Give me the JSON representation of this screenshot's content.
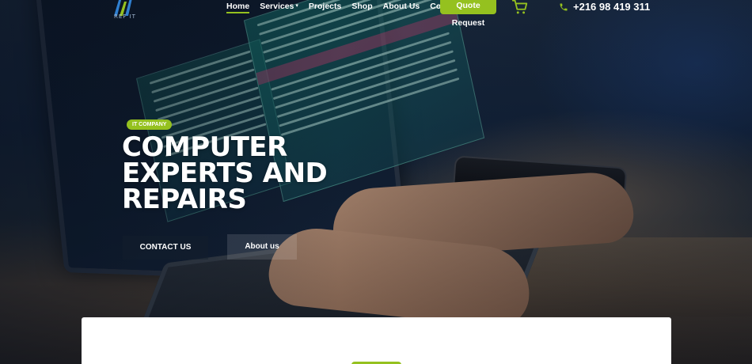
{
  "brand": {
    "logo_text": "REF IT",
    "accent": "#95c11f"
  },
  "nav": {
    "items": [
      {
        "label": "Home",
        "active": true
      },
      {
        "label": "Services",
        "active": false,
        "has_dropdown": true
      },
      {
        "label": "Projects",
        "active": false
      },
      {
        "label": "Shop",
        "active": false
      },
      {
        "label": "About Us",
        "active": false
      },
      {
        "label": "Contacts",
        "active": false
      }
    ],
    "quote_label": "Quote Request",
    "cart_icon": "cart-icon",
    "phone": "+216 98 419 311",
    "phone_icon": "phone-icon"
  },
  "hero": {
    "badge": "IT COMPANY",
    "headline_lines": [
      "COMPUTER",
      "EXPERTS AND",
      "REPAIRS"
    ],
    "primary_button": "CONTACT US",
    "secondary_button": "About us"
  }
}
